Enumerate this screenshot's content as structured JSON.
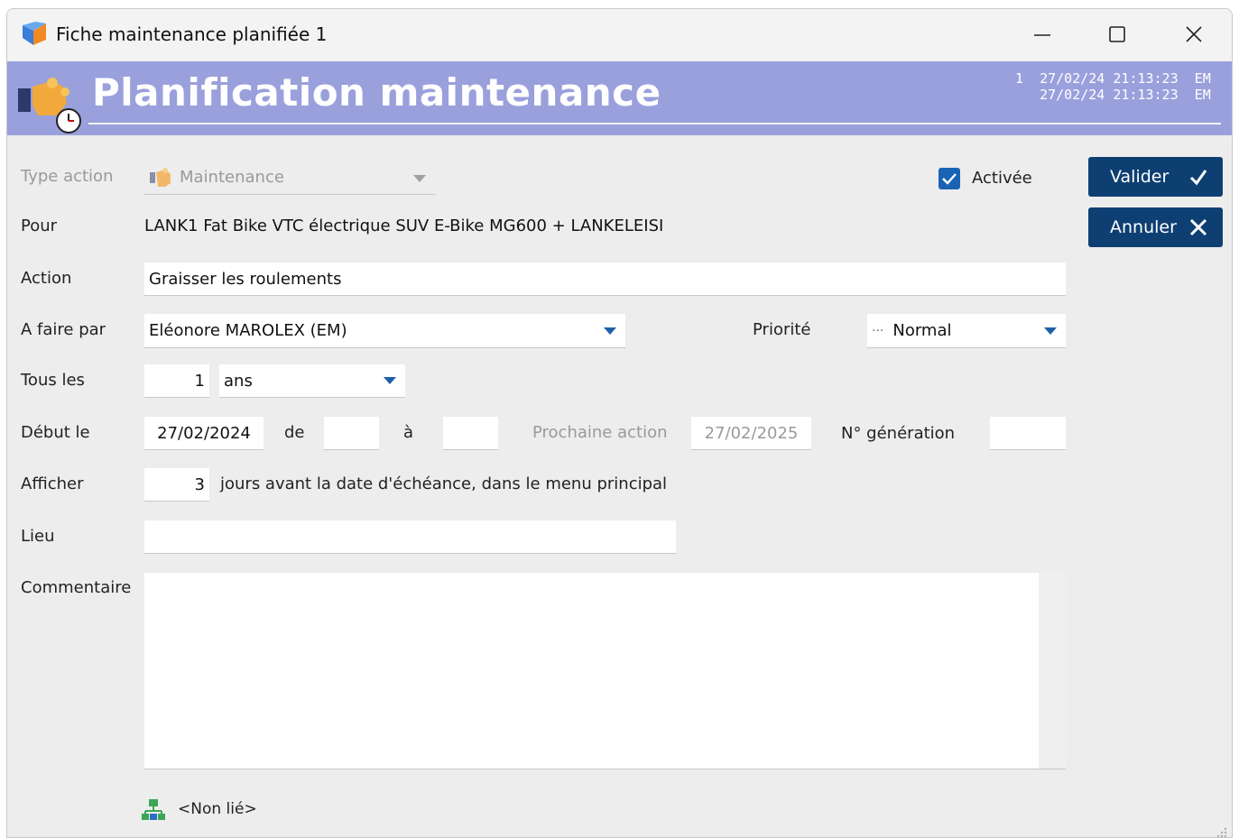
{
  "window": {
    "title": "Fiche maintenance planifiée 1",
    "controls": [
      "minimize-icon",
      "maximize-icon",
      "close-icon"
    ]
  },
  "banner": {
    "title": "Planification maintenance",
    "stamp_line1": "1  27/02/24 21:13:23  EM",
    "stamp_line2": "   27/02/24 21:13:23  EM"
  },
  "form": {
    "type_action": {
      "label": "Type action",
      "value": "Maintenance"
    },
    "activee": {
      "label": "Activée",
      "checked": true
    },
    "pour": {
      "label": "Pour",
      "value": "LANK1 Fat Bike VTC électrique SUV E-Bike MG600 + LANKELEISI"
    },
    "action": {
      "label": "Action",
      "value": "Graisser les roulements"
    },
    "a_faire_par": {
      "label": "A faire par",
      "value": "Eléonore MAROLEX (EM)"
    },
    "priorite": {
      "label": "Priorité",
      "value": "Normal",
      "prefix": "···"
    },
    "tous_les": {
      "label": "Tous les",
      "count": "1",
      "unit": "ans"
    },
    "debut_le": {
      "label": "Début le",
      "value": "27/02/2024"
    },
    "de": {
      "label": "de",
      "value": ""
    },
    "a": {
      "label": "à",
      "value": ""
    },
    "prochaine_action": {
      "label": "Prochaine action",
      "value": "27/02/2025"
    },
    "n_generation": {
      "label": "N° génération",
      "value": ""
    },
    "afficher": {
      "label": "Afficher",
      "value": "3",
      "suffix": "jours avant la date d'échéance, dans le menu principal"
    },
    "lieu": {
      "label": "Lieu",
      "value": ""
    },
    "commentaire": {
      "label": "Commentaire",
      "value": ""
    },
    "link": {
      "text": "<Non lié>"
    }
  },
  "buttons": {
    "valider": "Valider",
    "annuler": "Annuler"
  },
  "colors": {
    "banner": "#9aa0dc",
    "button": "#0e3f72",
    "checkbox": "#1a63b3",
    "dropdown_arrow": "#1e5fa8"
  }
}
